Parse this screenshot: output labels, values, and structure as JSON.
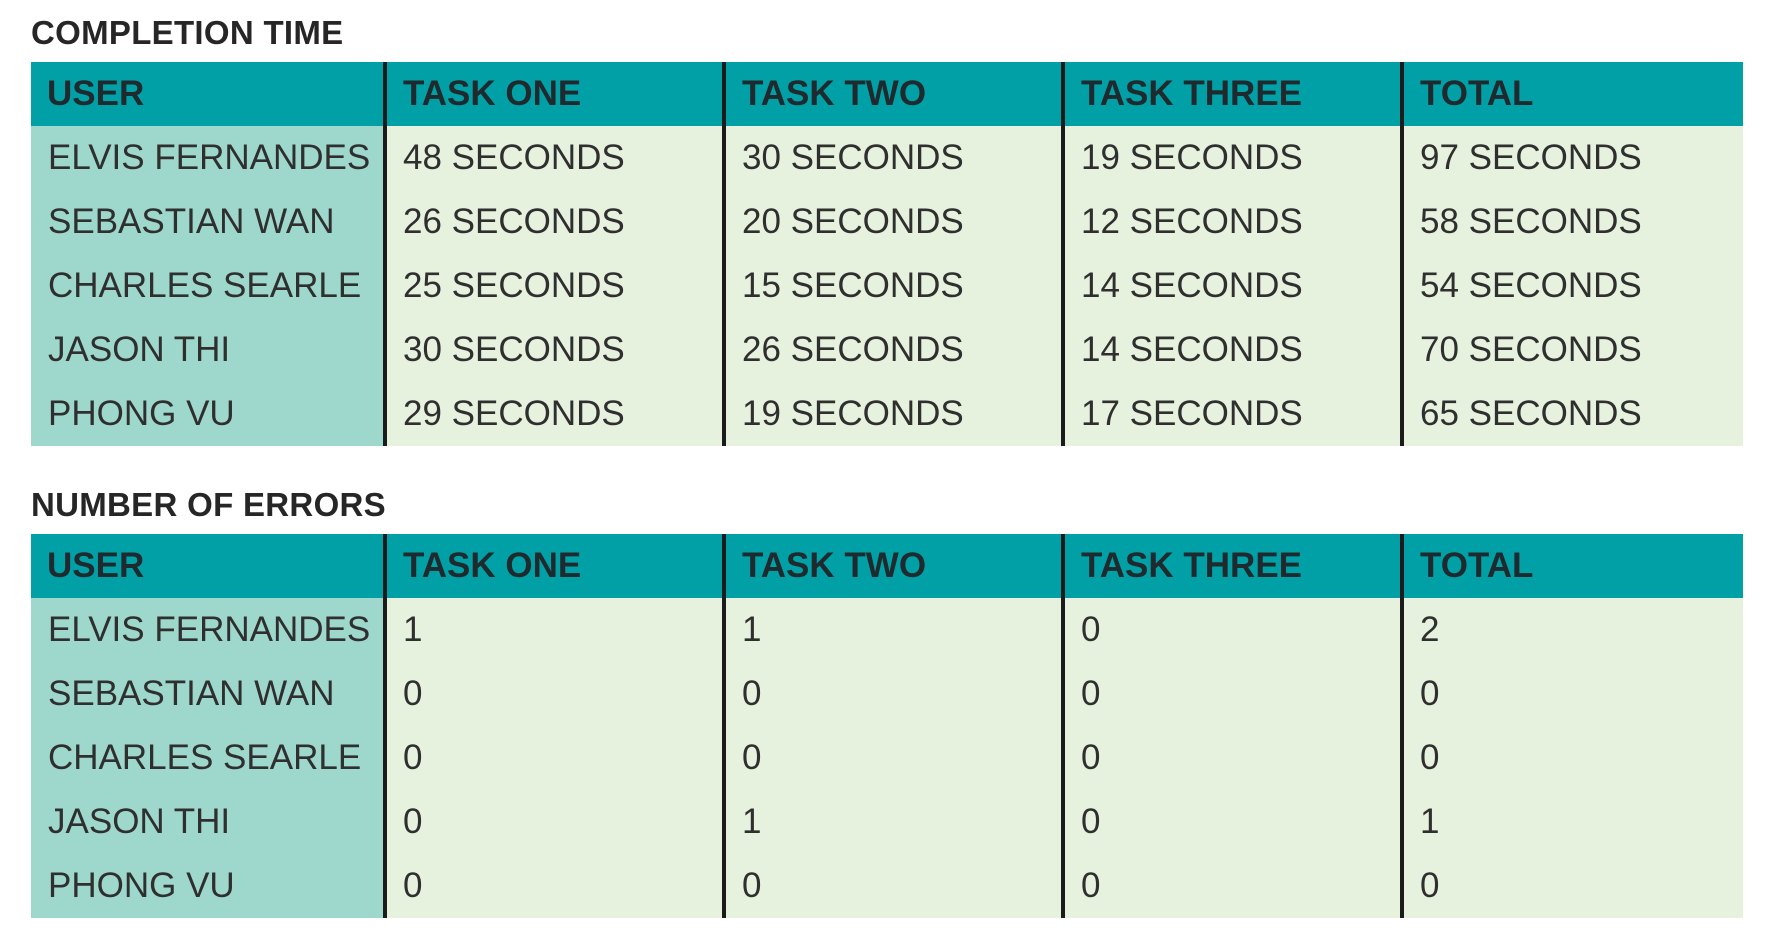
{
  "completion_time": {
    "title": "COMPLETION TIME",
    "headers": [
      "USER",
      "TASK ONE",
      "TASK TWO",
      "TASK THREE",
      "TOTAL"
    ],
    "rows": [
      [
        "ELVIS FERNANDES",
        "48 SECONDS",
        "30 SECONDS",
        "19 SECONDS",
        "97 SECONDS"
      ],
      [
        "SEBASTIAN WAN",
        "26 SECONDS",
        "20 SECONDS",
        "12 SECONDS",
        "58 SECONDS"
      ],
      [
        "CHARLES SEARLE",
        "25 SECONDS",
        "15 SECONDS",
        "14 SECONDS",
        "54 SECONDS"
      ],
      [
        "JASON THI",
        "30 SECONDS",
        "26 SECONDS",
        "14 SECONDS",
        "70 SECONDS"
      ],
      [
        "PHONG VU",
        "29 SECONDS",
        "19 SECONDS",
        "17 SECONDS",
        "65 SECONDS"
      ]
    ]
  },
  "number_of_errors": {
    "title": "NUMBER OF ERRORS",
    "headers": [
      "USER",
      "TASK ONE",
      "TASK TWO",
      "TASK THREE",
      "TOTAL"
    ],
    "rows": [
      [
        "ELVIS FERNANDES",
        "1",
        "1",
        "0",
        "2"
      ],
      [
        "SEBASTIAN WAN",
        "0",
        "0",
        "0",
        "0"
      ],
      [
        "CHARLES SEARLE",
        "0",
        "0",
        "0",
        "0"
      ],
      [
        "JASON THI",
        "0",
        "1",
        "0",
        "1"
      ],
      [
        "PHONG VU",
        "0",
        "0",
        "0",
        "0"
      ]
    ]
  },
  "colors": {
    "header_bg": "#00a0a6",
    "user_column_bg": "#9ed8cc",
    "body_bg": "#e6f1de",
    "divider": "#1b1b1b"
  }
}
